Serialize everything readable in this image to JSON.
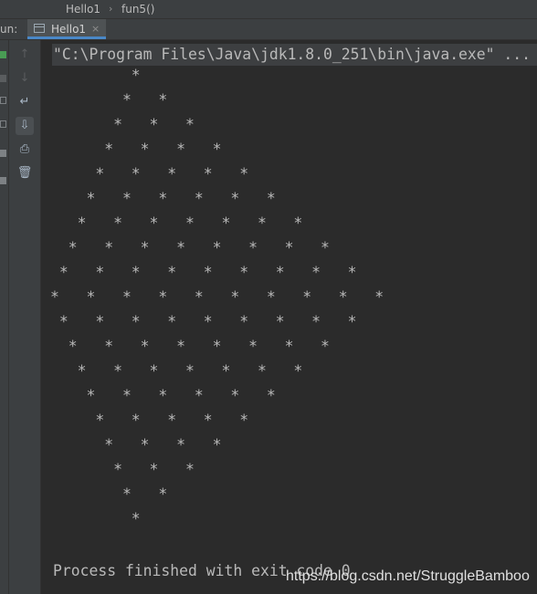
{
  "breadcrumb": {
    "file": "Hello1",
    "method": "fun5()"
  },
  "run_panel": {
    "label": "un:",
    "tab_label": "Hello1",
    "tab_icon": "console-tab-icon",
    "close_glyph": "×"
  },
  "toolbar": {
    "up_glyph": "↑",
    "down_glyph": "↓",
    "wrap_glyph": "↵",
    "scroll_end_glyph": "⇩",
    "print_glyph": "⎙",
    "trash_glyph": "🗑"
  },
  "console": {
    "command": "\"C:\\Program Files\\Java\\jdk1.8.0_251\\bin\\java.exe\" ...",
    "output_lines": [
      "         *",
      "        *   *",
      "       *   *   *",
      "      *   *   *   *",
      "     *   *   *   *   *",
      "    *   *   *   *   *   *",
      "   *   *   *   *   *   *   *",
      "  *   *   *   *   *   *   *   *",
      " *   *   *   *   *   *   *   *   *",
      "*   *   *   *   *   *   *   *   *   *",
      " *   *   *   *   *   *   *   *   *",
      "  *   *   *   *   *   *   *   *",
      "   *   *   *   *   *   *   *",
      "    *   *   *   *   *   *",
      "     *   *   *   *   *",
      "      *   *   *   *",
      "       *   *   *",
      "        *   *",
      "         *"
    ],
    "process_text": "Process finished with exit code 0"
  },
  "watermark": "https://blog.csdn.net/StruggleBamboo",
  "colors": {
    "background": "#2b2b2b",
    "panel": "#3c3f41",
    "text": "#b9b9b9",
    "tab_accent": "#4a88c7"
  }
}
